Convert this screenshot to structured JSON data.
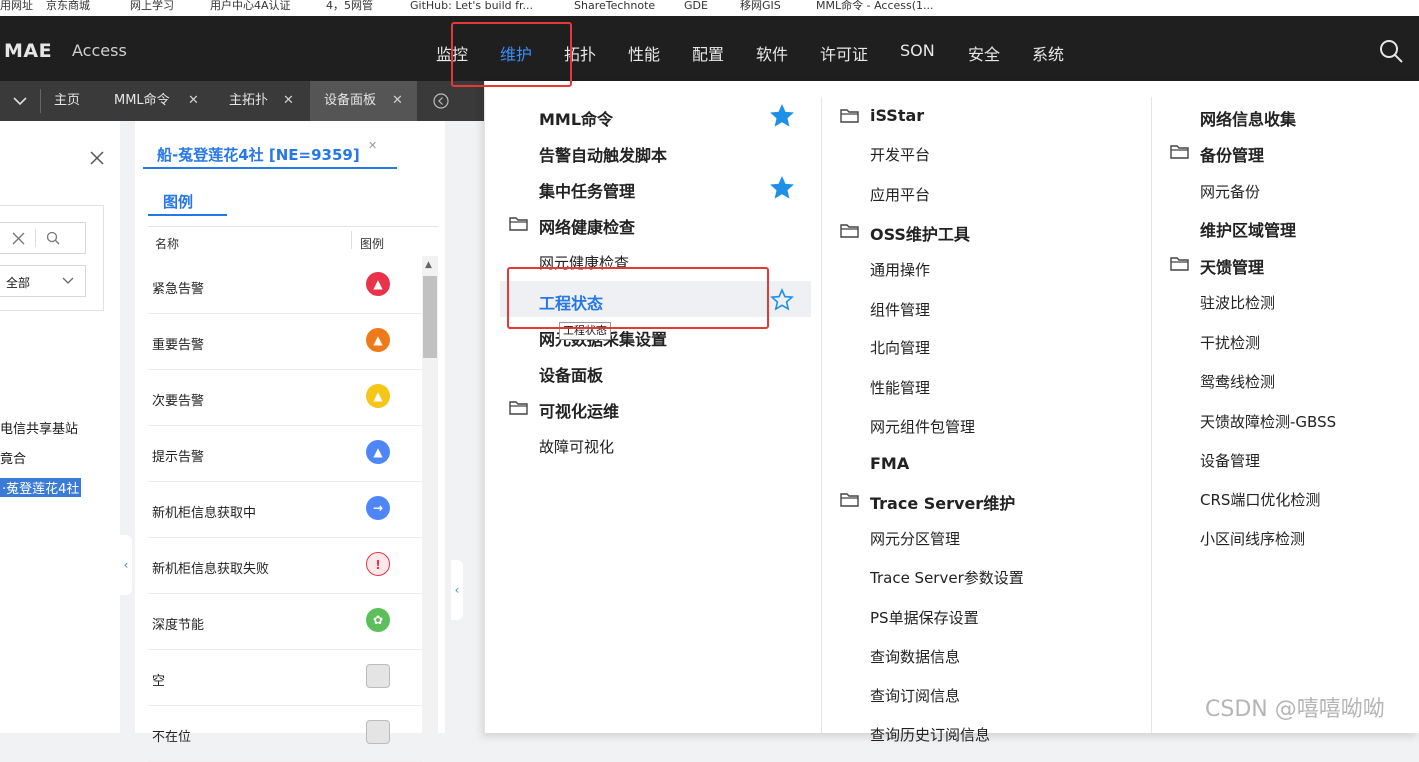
{
  "bookmarks": [
    "用网址",
    "京东商城",
    "网上学习",
    "用户中心4A认证",
    "4，5网管",
    "GitHub: Let's build fr...",
    "ShareTechnote",
    "GDE",
    "移网GIS",
    "MML命令 - Access(1..."
  ],
  "header": {
    "logo": "MAE",
    "app_name": "Access",
    "nav": [
      "监控",
      "维护",
      "拓扑",
      "性能",
      "配置",
      "软件",
      "许可证",
      "SON",
      "安全",
      "系统"
    ],
    "active_nav": "维护"
  },
  "tabs": [
    "主页",
    "MML命令",
    "主拓扑",
    "设备面板"
  ],
  "left_panel": {
    "filter_value": "全部",
    "tree_items": [
      "电信共享基站",
      "竟合",
      "·菟登莲花4社"
    ]
  },
  "ne_panel": {
    "title": "船-菟登莲花4社 [NE=9359]",
    "legend_tab": "图例",
    "col_name": "名称",
    "col_icon": "图例",
    "rows": [
      {
        "name": "紧急告警",
        "color": "#e8334a",
        "glyph": "▲"
      },
      {
        "name": "重要告警",
        "color": "#ef7a1a",
        "glyph": "▲"
      },
      {
        "name": "次要告警",
        "color": "#f5c518",
        "glyph": "▲"
      },
      {
        "name": "提示告警",
        "color": "#4f86f7",
        "glyph": "▲"
      },
      {
        "name": "新机柜信息获取中",
        "color": "#4f86f7",
        "glyph": "→"
      },
      {
        "name": "新机柜信息获取失败",
        "color": "#fde8ea",
        "glyph": "!"
      },
      {
        "name": "深度节能",
        "color": "#5cbf5c",
        "glyph": "✿"
      },
      {
        "name": "空",
        "color": "#e4e4e4",
        "glyph": ""
      },
      {
        "name": "不在位",
        "color": "#e4e4e4",
        "glyph": ""
      }
    ]
  },
  "menu": {
    "col1": [
      {
        "label": "MML命令",
        "type": "bold",
        "star": "filled"
      },
      {
        "label": "告警自动触发脚本",
        "type": "bold"
      },
      {
        "label": "集中任务管理",
        "type": "bold",
        "star": "filled"
      },
      {
        "label": "网络健康检查",
        "type": "folder"
      },
      {
        "label": "网元健康检查",
        "type": "sub"
      },
      {
        "label": "工程状态",
        "type": "bold-hl",
        "star": "outline"
      },
      {
        "label": "网元数据采集设置",
        "type": "bold"
      },
      {
        "label": "设备面板",
        "type": "bold"
      },
      {
        "label": "可视化运维",
        "type": "folder"
      },
      {
        "label": "故障可视化",
        "type": "sub"
      }
    ],
    "tooltip": "工程状态",
    "col2": [
      {
        "label": "iSStar",
        "type": "folder"
      },
      {
        "label": "开发平台",
        "type": "sub"
      },
      {
        "label": "应用平台",
        "type": "sub"
      },
      {
        "label": "OSS维护工具",
        "type": "folder"
      },
      {
        "label": "通用操作",
        "type": "sub"
      },
      {
        "label": "组件管理",
        "type": "sub"
      },
      {
        "label": "北向管理",
        "type": "sub"
      },
      {
        "label": "性能管理",
        "type": "sub"
      },
      {
        "label": "网元组件包管理",
        "type": "sub"
      },
      {
        "label": "FMA",
        "type": "bold"
      },
      {
        "label": "Trace Server维护",
        "type": "folder"
      },
      {
        "label": "网元分区管理",
        "type": "sub"
      },
      {
        "label": "Trace Server参数设置",
        "type": "sub"
      },
      {
        "label": "PS单据保存设置",
        "type": "sub"
      },
      {
        "label": "查询数据信息",
        "type": "sub"
      },
      {
        "label": "查询订阅信息",
        "type": "sub"
      },
      {
        "label": "查询历史订阅信息",
        "type": "sub"
      }
    ],
    "col3": [
      {
        "label": "网络信息收集",
        "type": "bold"
      },
      {
        "label": "备份管理",
        "type": "folder"
      },
      {
        "label": "网元备份",
        "type": "sub"
      },
      {
        "label": "维护区域管理",
        "type": "bold"
      },
      {
        "label": "天馈管理",
        "type": "folder"
      },
      {
        "label": "驻波比检测",
        "type": "sub"
      },
      {
        "label": "干扰检测",
        "type": "sub"
      },
      {
        "label": "鸳鸯线检测",
        "type": "sub"
      },
      {
        "label": "天馈故障检测-GBSS",
        "type": "sub"
      },
      {
        "label": "设备管理",
        "type": "sub"
      },
      {
        "label": "CRS端口优化检测",
        "type": "sub"
      },
      {
        "label": "小区间线序检测",
        "type": "sub"
      }
    ]
  },
  "watermark": "CSDN @嘻嘻呦呦",
  "colors": {
    "accent": "#2677e8",
    "header_bg": "#1f1f1f",
    "highlight": "#e53935"
  }
}
